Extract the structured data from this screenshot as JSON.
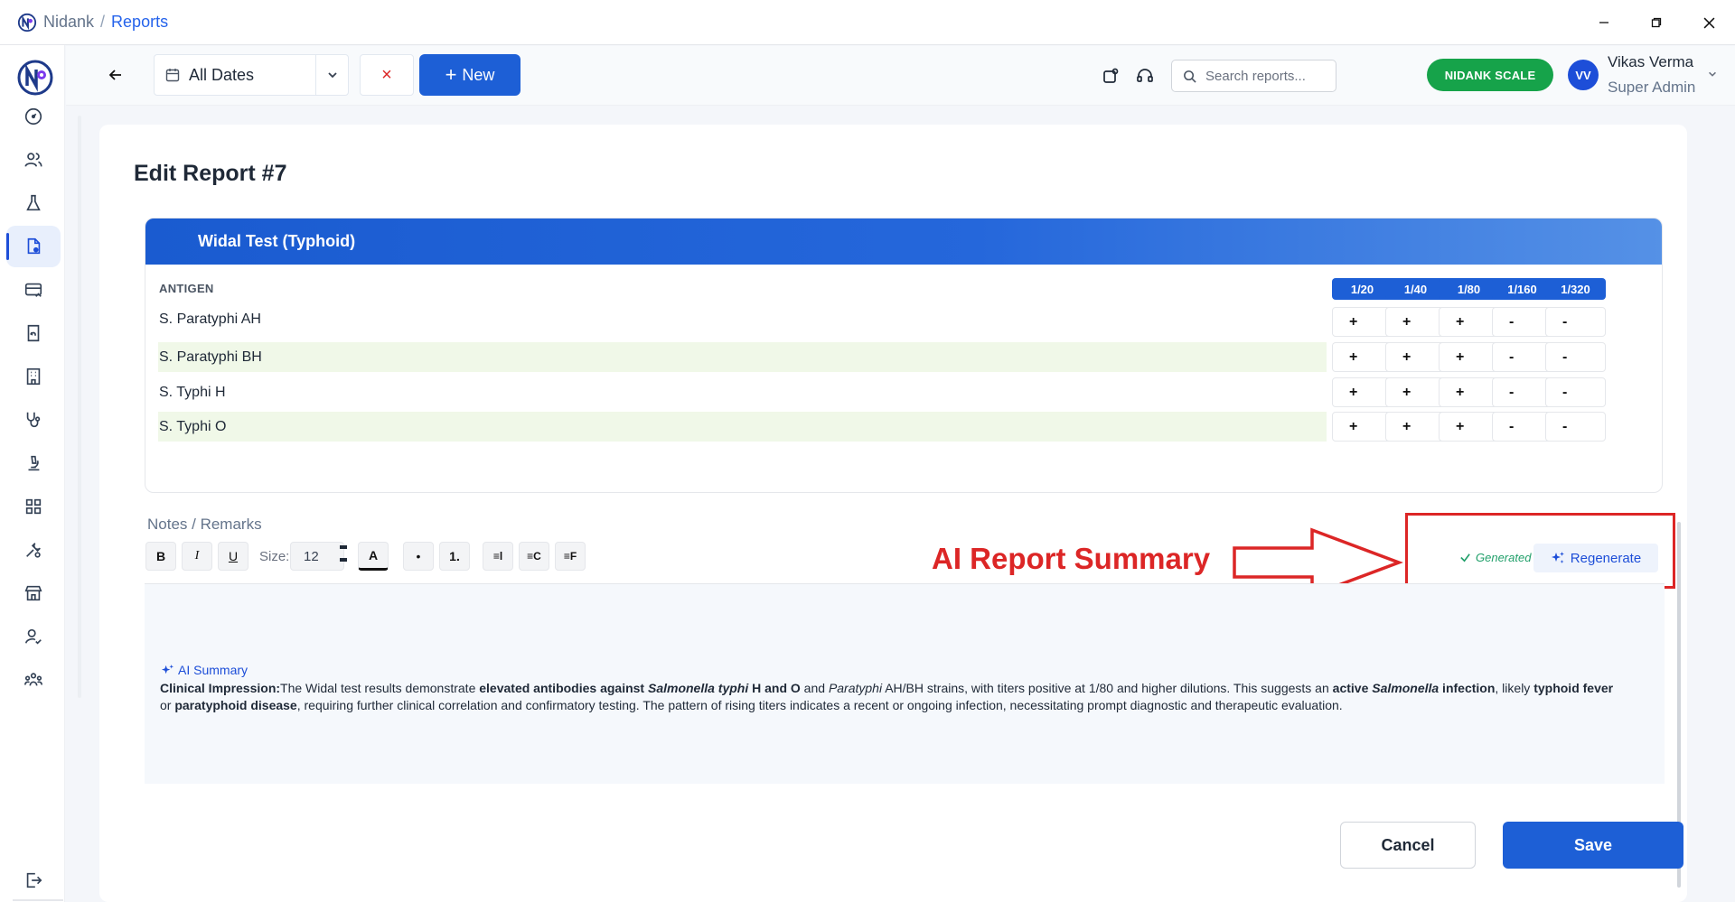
{
  "titlebar": {
    "app_name": "Nidank",
    "separator": "/",
    "page": "Reports",
    "controls": [
      "minimize-icon",
      "restore-icon",
      "close-icon"
    ]
  },
  "sidebar": {
    "items": [
      {
        "icon": "dashboard-gauge-icon",
        "active": false
      },
      {
        "icon": "users-icon",
        "active": false
      },
      {
        "icon": "flask-icon",
        "active": false
      },
      {
        "icon": "report-document-icon",
        "active": true
      },
      {
        "icon": "billing-card-icon",
        "active": false
      },
      {
        "icon": "refund-receipt-icon",
        "active": false
      },
      {
        "icon": "building-icon",
        "active": false
      },
      {
        "icon": "stethoscope-icon",
        "active": false
      },
      {
        "icon": "microscope-icon",
        "active": false
      },
      {
        "icon": "grid-apps-icon",
        "active": false
      },
      {
        "icon": "tools-icon",
        "active": false
      },
      {
        "icon": "store-icon",
        "active": false
      },
      {
        "icon": "user-check-icon",
        "active": false
      },
      {
        "icon": "team-icon",
        "active": false
      }
    ],
    "logout_icon": "logout-icon"
  },
  "toolbar": {
    "date_filter": "All Dates",
    "clear_symbol": "×",
    "new_label": "New",
    "new_symbol": "+",
    "search_placeholder": "Search reports...",
    "scale_label": "NIDANK SCALE",
    "avatar_initials": "VV",
    "user_name": "Vikas Verma",
    "user_role": "Super Admin"
  },
  "page": {
    "title": "Edit Report #7"
  },
  "test": {
    "name": "Widal Test (Typhoid)",
    "antigen_header": "ANTIGEN",
    "dilutions": [
      "1/20",
      "1/40",
      "1/80",
      "1/160",
      "1/320"
    ],
    "rows": [
      {
        "antigen": "S. Paratyphi AH",
        "results": [
          "+",
          "+",
          "+",
          "-",
          "-"
        ],
        "shaded": false
      },
      {
        "antigen": "S. Paratyphi BH",
        "results": [
          "+",
          "+",
          "+",
          "-",
          "-"
        ],
        "shaded": true
      },
      {
        "antigen": "S. Typhi H",
        "results": [
          "+",
          "+",
          "+",
          "-",
          "-"
        ],
        "shaded": false
      },
      {
        "antigen": "S. Typhi O",
        "results": [
          "+",
          "+",
          "+",
          "-",
          "-"
        ],
        "shaded": true
      }
    ]
  },
  "notes": {
    "label": "Notes / Remarks",
    "toolbar": {
      "bold": "B",
      "italic": "I",
      "underline": "U",
      "size_label": "Size:",
      "size_value": "12",
      "color": "A",
      "bullet": "•",
      "numbered": "1.",
      "align_left": "≡l",
      "align_center": "≡C",
      "align_justify": "≡F"
    },
    "ai_tag": "AI Summary",
    "summary": {
      "p1": "Clinical Impression:",
      "p2": "The Widal test results demonstrate ",
      "p3": "elevated antibodies against ",
      "p4": "Salmonella typhi",
      "p5": " H and O",
      "p6": " and ",
      "p7": "Paratyphi",
      "p8": " AH/BH strains, with titers positive at 1/80 and higher dilutions. This suggests an ",
      "p9": "active ",
      "p10": "Salmonella",
      "p11": " infection",
      "p12": ", likely ",
      "p13": "typhoid fever",
      "p14": " or ",
      "p15": "paratyphoid disease",
      "p16": ", requiring further clinical correlation and confirmatory testing. The pattern of rising titers indicates a recent or ongoing infection, necessitating prompt diagnostic and therapeutic evaluation."
    },
    "generated_label": "Generated",
    "regenerate_label": "Regenerate"
  },
  "annotation": {
    "text": "AI Report Summary",
    "color": "#dc2626"
  },
  "actions": {
    "cancel": "Cancel",
    "save": "Save"
  },
  "colors": {
    "primary": "#1d5fd6",
    "success": "#16a34a",
    "row_shade": "#f0f8e8"
  }
}
